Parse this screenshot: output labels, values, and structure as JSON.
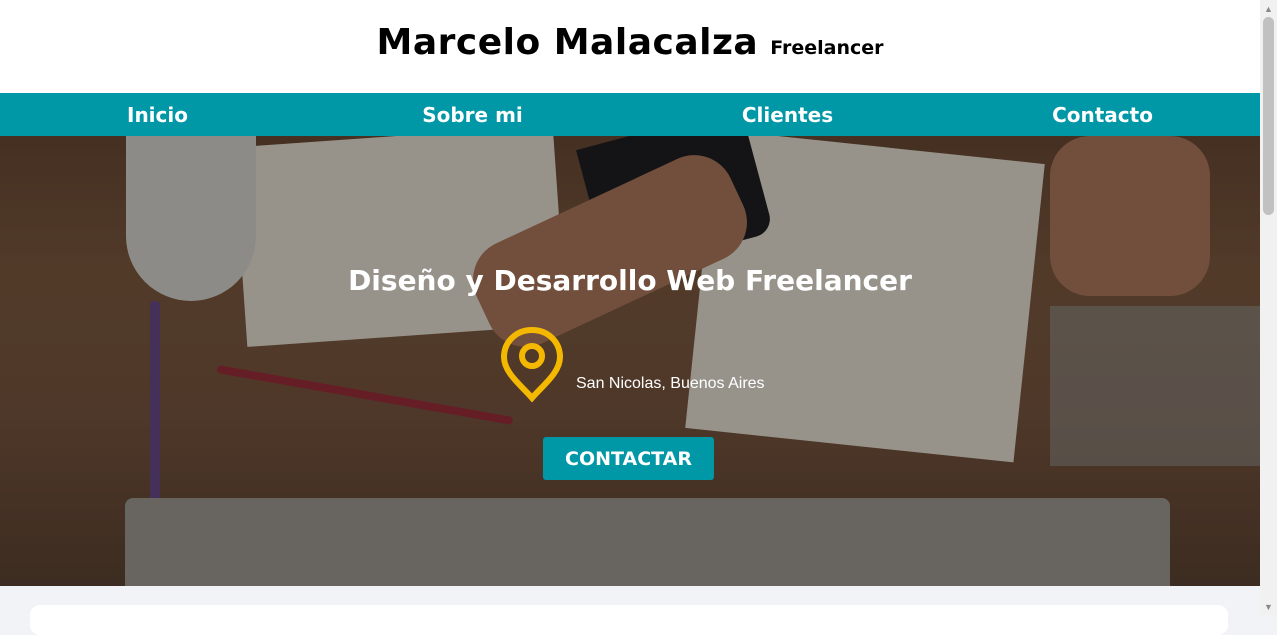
{
  "header": {
    "name": "Marcelo Malacalza",
    "tagline": "Freelancer"
  },
  "nav": {
    "items": [
      {
        "label": "Inicio"
      },
      {
        "label": "Sobre mi"
      },
      {
        "label": "Clientes"
      },
      {
        "label": "Contacto"
      }
    ]
  },
  "hero": {
    "title": "Diseño y Desarrollo Web Freelancer",
    "location": "San Nicolas, Buenos Aires",
    "location_icon": "map-pin-icon",
    "cta_label": "CONTACTAR"
  },
  "colors": {
    "accent": "#0097a7",
    "pin": "#f5b800",
    "nav_text": "#ffffff"
  }
}
